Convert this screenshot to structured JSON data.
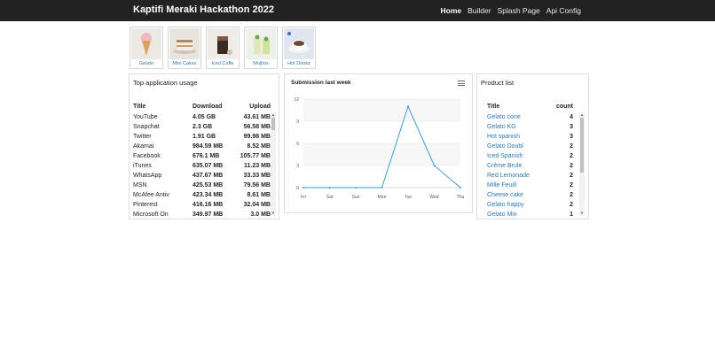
{
  "app": {
    "title": "Kaptifi Meraki Hackathon 2022"
  },
  "nav": [
    {
      "label": "Home",
      "active": true
    },
    {
      "label": "Builder",
      "active": false
    },
    {
      "label": "Splash Page",
      "active": false
    },
    {
      "label": "Api Config",
      "active": false
    }
  ],
  "categories": [
    {
      "label": "Gelato",
      "icon": "ice-cream-cone"
    },
    {
      "label": "Mini Cakes",
      "icon": "cake-slice"
    },
    {
      "label": "Iced Coffe",
      "icon": "iced-coffee"
    },
    {
      "label": "Mojitos",
      "icon": "mojito-glass"
    },
    {
      "label": "Hot Drinks",
      "icon": "coffee-cup"
    }
  ],
  "usage": {
    "title": "Top application usage",
    "headers": {
      "title": "Title",
      "download": "Download",
      "upload": "Upload"
    },
    "rows": [
      {
        "title": "YouTube",
        "download": "4.05 GB",
        "upload": "43.61 MB"
      },
      {
        "title": "Snapchat",
        "download": "2.3 GB",
        "upload": "56.58 MB"
      },
      {
        "title": "Twitter",
        "download": "1.91 GB",
        "upload": "99.98 MB"
      },
      {
        "title": "Akamai",
        "download": "984.59 MB",
        "upload": "8.52 MB"
      },
      {
        "title": "Facebook",
        "download": "676.1 MB",
        "upload": "105.77 MB"
      },
      {
        "title": "iTunes",
        "download": "635.07 MB",
        "upload": "11.23 MB"
      },
      {
        "title": "WhatsApp",
        "download": "437.67 MB",
        "upload": "33.33 MB"
      },
      {
        "title": "MSN",
        "download": "425.53 MB",
        "upload": "79.56 MB"
      },
      {
        "title": "McAfee Antiv",
        "download": "423.34 MB",
        "upload": "8.61 MB"
      },
      {
        "title": "Pinterest",
        "download": "416.16 MB",
        "upload": "32.04 MB"
      },
      {
        "title": "Microsoft On",
        "download": "349.97 MB",
        "upload": "3.0 MB"
      }
    ]
  },
  "chart_data": {
    "type": "line",
    "title": "Submission last week",
    "categories": [
      "Fri",
      "Sat",
      "Sun",
      "Mon",
      "Tue",
      "Wed",
      "Thu"
    ],
    "series": [
      {
        "values": [
          0,
          0,
          0,
          0,
          11,
          3,
          0
        ]
      }
    ],
    "yticks": [
      0,
      3,
      6,
      9,
      12
    ],
    "ylim": [
      0,
      12
    ],
    "line_color": "#3e9bd4",
    "grid": true,
    "legend": "none"
  },
  "products": {
    "title": "Product list",
    "headers": {
      "name": "Title",
      "count": "count"
    },
    "rows": [
      {
        "name": "Gelato cone",
        "count": "4"
      },
      {
        "name": "Gelato KG",
        "count": "3"
      },
      {
        "name": "Hot spanish",
        "count": "3"
      },
      {
        "name": "Gelato Doubl",
        "count": "2"
      },
      {
        "name": "Iced Spanish",
        "count": "2"
      },
      {
        "name": "Crème Brule",
        "count": "2"
      },
      {
        "name": "Red Lemonade",
        "count": "2"
      },
      {
        "name": "Mille Feuill",
        "count": "2"
      },
      {
        "name": "Cheese cake",
        "count": "2"
      },
      {
        "name": "Gelato happy",
        "count": "2"
      },
      {
        "name": "Gelato Mix",
        "count": "1"
      }
    ]
  },
  "colors": {
    "navbar": "#222222",
    "link": "#2b7ab8",
    "chart_line": "#3e9bd4"
  }
}
